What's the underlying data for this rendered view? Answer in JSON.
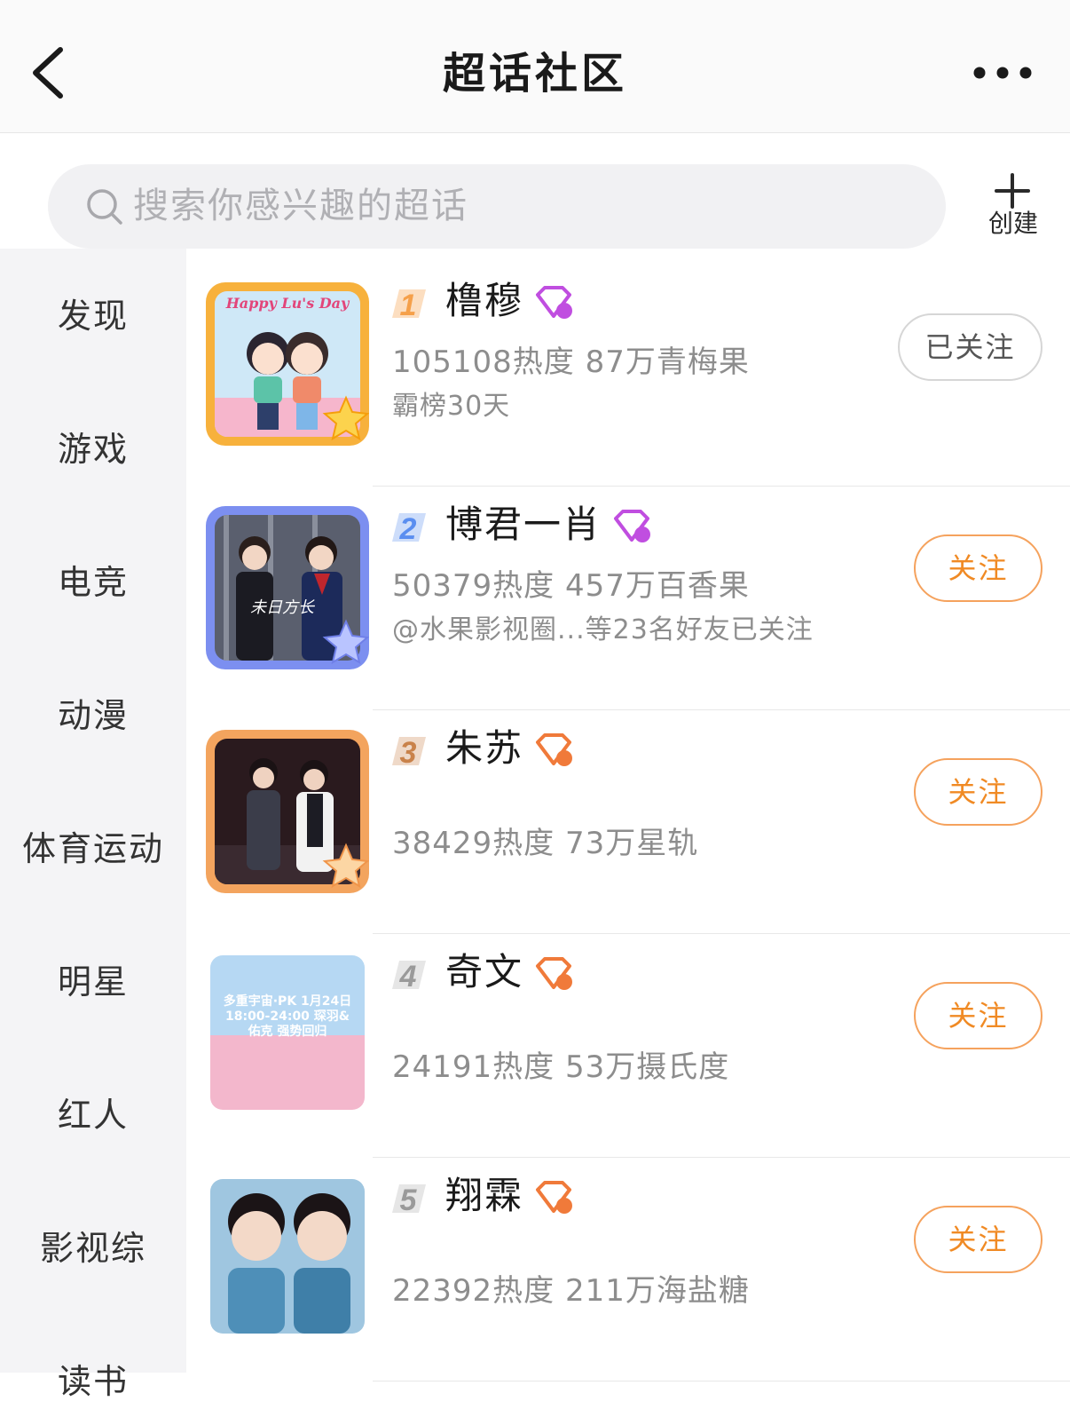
{
  "header": {
    "title": "超话社区"
  },
  "search": {
    "placeholder": "搜索你感兴趣的超话",
    "create_label": "创建"
  },
  "sidebar": {
    "items": [
      {
        "label": "发现"
      },
      {
        "label": "游戏"
      },
      {
        "label": "电竞"
      },
      {
        "label": "动漫"
      },
      {
        "label": "体育运动"
      },
      {
        "label": "明星"
      },
      {
        "label": "红人"
      },
      {
        "label": "影视综"
      },
      {
        "label": "读书"
      }
    ]
  },
  "topics": [
    {
      "rank": "1",
      "name": "橹穆",
      "stats": "105108热度 87万青梅果",
      "sub": "霸榜30天",
      "follow_label": "已关注",
      "followed": true,
      "cover_caption": "Happy Lu's Day",
      "rank_color": "#f5a04a",
      "badge_color": "#c04ee0"
    },
    {
      "rank": "2",
      "name": "博君一肖",
      "stats": "50379热度 457万百香果",
      "sub": "@水果影视圈...等23名好友已关注",
      "follow_label": "关注",
      "followed": false,
      "cover_caption": "未日方长",
      "rank_color": "#5a8ef0",
      "badge_color": "#c04ee0"
    },
    {
      "rank": "3",
      "name": "朱苏",
      "stats": "38429热度 73万星轨",
      "sub": "",
      "follow_label": "关注",
      "followed": false,
      "cover_caption": "",
      "rank_color": "#c9824a",
      "badge_color": "#f07a3a"
    },
    {
      "rank": "4",
      "name": "奇文",
      "stats": "24191热度 53万摄氏度",
      "sub": "",
      "follow_label": "关注",
      "followed": false,
      "cover_caption": "多重宇宙·PK 1月24日 18:00-24:00 琛羽&佑克 强势回归",
      "rank_color": "#9a9a9a",
      "badge_color": "#f07a3a"
    },
    {
      "rank": "5",
      "name": "翔霖",
      "stats": "22392热度 211万海盐糖",
      "sub": "",
      "follow_label": "关注",
      "followed": false,
      "cover_caption": "",
      "rank_color": "#9a9a9a",
      "badge_color": "#f07a3a"
    }
  ],
  "colors": {
    "accent": "#f08a24",
    "sidebar_bg": "#f4f4f6",
    "secondary_text": "#8d8d8d"
  }
}
